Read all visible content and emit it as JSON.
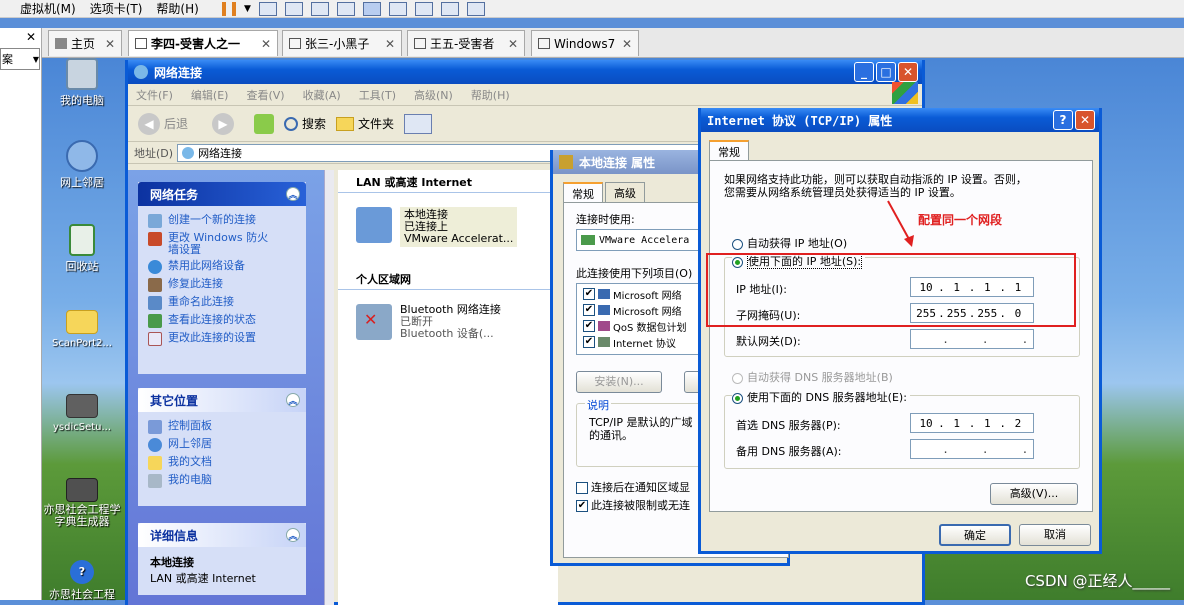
{
  "vmware": {
    "menu": [
      "虚拟机(M)",
      "选项卡(T)",
      "帮助(H)"
    ],
    "tabs": [
      {
        "label": "主页"
      },
      {
        "label": "李四-受害人之一"
      },
      {
        "label": "张三-小黑子"
      },
      {
        "label": "王五-受害者"
      },
      {
        "label": "Windows7"
      }
    ],
    "left_combo": "案"
  },
  "desktop_icons": [
    {
      "label": "我的电脑"
    },
    {
      "label": "网上邻居"
    },
    {
      "label": "回收站"
    },
    {
      "label": "ScanPort2..."
    },
    {
      "label": "ysdicSetu..."
    },
    {
      "label": "亦思社会工程学字典生成器"
    },
    {
      "label": "亦思社会工程"
    }
  ],
  "netwin": {
    "title": "网络连接",
    "menu": [
      "文件(F)",
      "编辑(E)",
      "查看(V)",
      "收藏(A)",
      "工具(T)",
      "高级(N)",
      "帮助(H)"
    ],
    "back": "后退",
    "search": "搜索",
    "folders": "文件夹",
    "address_label": "地址(D)",
    "address_value": "网络连接",
    "tasks_title": "网络任务",
    "tasks": [
      "创建一个新的连接",
      "更改 Windows 防火墙设置",
      "禁用此网络设备",
      "修复此连接",
      "重命名此连接",
      "查看此连接的状态",
      "更改此连接的设置"
    ],
    "other_title": "其它位置",
    "other": [
      "控制面板",
      "网上邻居",
      "我的文档",
      "我的电脑"
    ],
    "details_title": "详细信息",
    "details_name": "本地连接",
    "details_type": "LAN 或高速 Internet",
    "group_lan": "LAN 或高速 Internet",
    "lan_item": {
      "name": "本地连接",
      "status": "已连接上",
      "device": "VMware Accelerat..."
    },
    "group_pan": "个人区域网",
    "bt_item": {
      "name": "Bluetooth 网络连接",
      "status": "已断开",
      "device": "Bluetooth 设备(..."
    }
  },
  "propwin": {
    "title": "本地连接 属性",
    "tab_general": "常规",
    "tab_advanced": "高级",
    "connect_using": "连接时使用:",
    "adapter": "VMware Accelera",
    "items_label": "此连接使用下列项目(O)",
    "items": [
      "Microsoft 网络",
      "Microsoft 网络",
      "QoS 数据包计划",
      "Internet 协议"
    ],
    "install": "安装(N)...",
    "desc_title": "说明",
    "desc_text": "TCP/IP 是默认的广域网协议。它提供跨越多种互联网络的通讯。",
    "desc_line1": "TCP/IP 是默认的广域",
    "desc_line2": "的通讯。",
    "notify": "连接后在通知区域显",
    "limited": "此连接被限制或无连"
  },
  "tcpwin": {
    "title": "Internet 协议 (TCP/IP) 属性",
    "tab": "常规",
    "intro": "如果网络支持此功能，则可以获取自动指派的 IP 设置。否则，您需要从网络系统管理员处获得适当的 IP 设置。",
    "intro_line1": "如果网络支持此功能，则可以获取自动指派的 IP 设置。否则，",
    "intro_line2": "您需要从网络系统管理员处获得适当的 IP 设置。",
    "annotation": "配置同一个网段",
    "auto_ip": "自动获得 IP 地址(O)",
    "manual_ip": "使用下面的 IP 地址(S):",
    "ip_label": "IP 地址(I):",
    "ip": [
      "10",
      "1",
      "1",
      "1"
    ],
    "mask_label": "子网掩码(U):",
    "mask": [
      "255",
      "255",
      "255",
      "0"
    ],
    "gw_label": "默认网关(D):",
    "auto_dns": "自动获得 DNS 服务器地址(B)",
    "manual_dns": "使用下面的 DNS 服务器地址(E):",
    "dns1_label": "首选 DNS 服务器(P):",
    "dns1": [
      "10",
      "1",
      "1",
      "2"
    ],
    "dns2_label": "备用 DNS 服务器(A):",
    "advanced": "高级(V)...",
    "ok": "确定",
    "cancel": "取消"
  },
  "watermark": "CSDN @正经人_____",
  "colors": {
    "xp_blue": "#0a5bd6",
    "annotation_red": "#e02020",
    "link_blue": "#215dc6"
  }
}
